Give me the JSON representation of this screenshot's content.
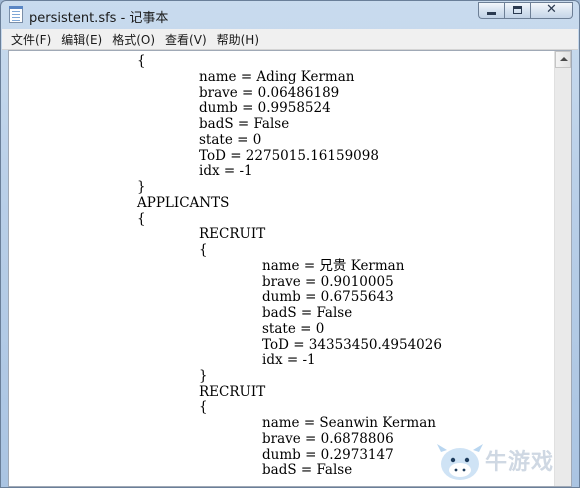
{
  "window": {
    "title": "persistent.sfs - 记事本",
    "icon": "notepad-icon"
  },
  "menu": [
    "文件(F)",
    "编辑(E)",
    "格式(O)",
    "查看(V)",
    "帮助(H)"
  ],
  "document": {
    "lines": [
      "{",
      "name = Ading Kerman",
      "brave = 0.06486189",
      "dumb = 0.9958524",
      "badS = False",
      "state = 0",
      "ToD = 2275015.16159098",
      "idx = -1",
      "}",
      "APPLICANTS",
      "{",
      "RECRUIT",
      "{",
      "name = 兄贵 Kerman",
      "brave = 0.9010005",
      "dumb = 0.6755643",
      "badS = False",
      "state = 0",
      "ToD = 34353450.4954026",
      "idx = -1",
      "}",
      "RECRUIT",
      "{",
      "name = Seanwin Kerman",
      "brave = 0.6878806",
      "dumb = 0.2973147",
      "badS = False"
    ]
  },
  "watermark": {
    "text": "牛游戏",
    "icon": "cow-mascot-icon"
  }
}
